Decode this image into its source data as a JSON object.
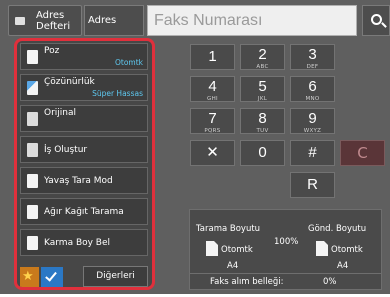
{
  "topbar": {
    "address_book_label": "Adres Defteri",
    "address_tab_label": "Adres",
    "fax_input_placeholder": "Faks Numarası"
  },
  "modes": [
    {
      "label": "Poz",
      "value": "Otomtk"
    },
    {
      "label": "Çözünürlük",
      "value": "Süper Hassas"
    },
    {
      "label": "Orijinal",
      "value": ""
    },
    {
      "label": "İş Oluştur",
      "value": ""
    },
    {
      "label": "Yavaş Tara Mod",
      "value": ""
    },
    {
      "label": "Ağır Kağıt Tarama",
      "value": ""
    },
    {
      "label": "Karma Boy Bel",
      "value": ""
    }
  ],
  "others_label": "Diğerleri",
  "keypad": {
    "keys": [
      {
        "digit": "1",
        "sub": ""
      },
      {
        "digit": "2",
        "sub": "ABC"
      },
      {
        "digit": "3",
        "sub": "DEF"
      },
      {
        "digit": "4",
        "sub": "GHI"
      },
      {
        "digit": "5",
        "sub": "JKL"
      },
      {
        "digit": "6",
        "sub": "MNO"
      },
      {
        "digit": "7",
        "sub": "PQRS"
      },
      {
        "digit": "8",
        "sub": "TUV"
      },
      {
        "digit": "9",
        "sub": "WXYZ"
      }
    ],
    "pause_symbol": "✕",
    "zero": "0",
    "hash": "#",
    "clear": "C",
    "redial": "R"
  },
  "status": {
    "scan_size_label": "Tarama Boyutu",
    "scan_size_value": "Otomtk",
    "scan_size_paper": "A4",
    "ratio": "100%",
    "send_size_label": "Gönd. Boyutu",
    "send_size_value": "Otomtk",
    "send_size_paper": "A4",
    "memory_label": "Faks alım belleği:",
    "memory_value": "0%"
  },
  "colors": {
    "highlight_border": "#e0303c",
    "value_text": "#5ec8f0",
    "favorite": "#c97a1c",
    "check": "#2b78c5"
  }
}
